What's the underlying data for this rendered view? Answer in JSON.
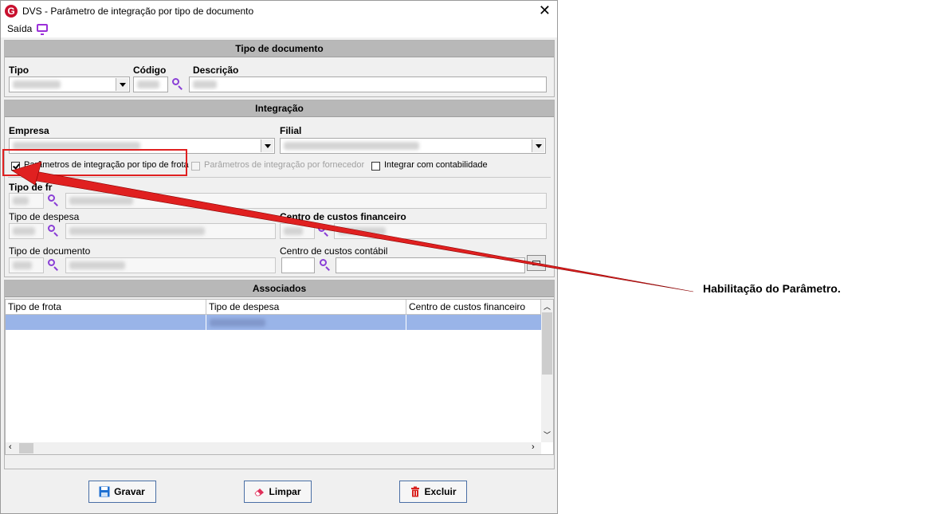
{
  "window": {
    "logo_letter": "G",
    "title": "DVS - Parâmetro de integração por tipo de documento",
    "close_glyph": "✕"
  },
  "menu": {
    "saida": "Saída",
    "monitor_icon": "monitor-icon"
  },
  "tipo_documento": {
    "header": "Tipo de documento",
    "tipo_label": "Tipo",
    "codigo_label": "Código",
    "descricao_label": "Descrição"
  },
  "integracao": {
    "header": "Integração",
    "empresa_label": "Empresa",
    "filial_label": "Filial",
    "cb_frota": {
      "label": "Parâmetros de integração por tipo de frota",
      "checked": true
    },
    "cb_fornecedor": {
      "label": "Parâmetros de integração por fornecedor",
      "checked": false,
      "enabled": false
    },
    "cb_contabilidade": {
      "label": "Integrar com contabilidade",
      "checked": false
    },
    "tipo_frota_label": "Tipo de fr",
    "tipo_despesa_label": "Tipo de despesa",
    "centro_fin_label": "Centro de custos financeiro",
    "tipo_doc_label": "Tipo de documento",
    "centro_cont_label": "Centro de custos contábil"
  },
  "associados": {
    "header": "Associados",
    "columns": [
      "Tipo de frota",
      "Tipo de despesa",
      "Centro de custos financeiro"
    ]
  },
  "buttons": {
    "gravar": "Gravar",
    "limpar": "Limpar",
    "excluir": "Excluir"
  },
  "annotation": {
    "text": "Habilitação do Parâmetro.",
    "color": "#e02020"
  },
  "colors": {
    "section_header": "#b8b8b8",
    "selection": "#99b4e8",
    "accent_icon": "#8a3fd6"
  }
}
